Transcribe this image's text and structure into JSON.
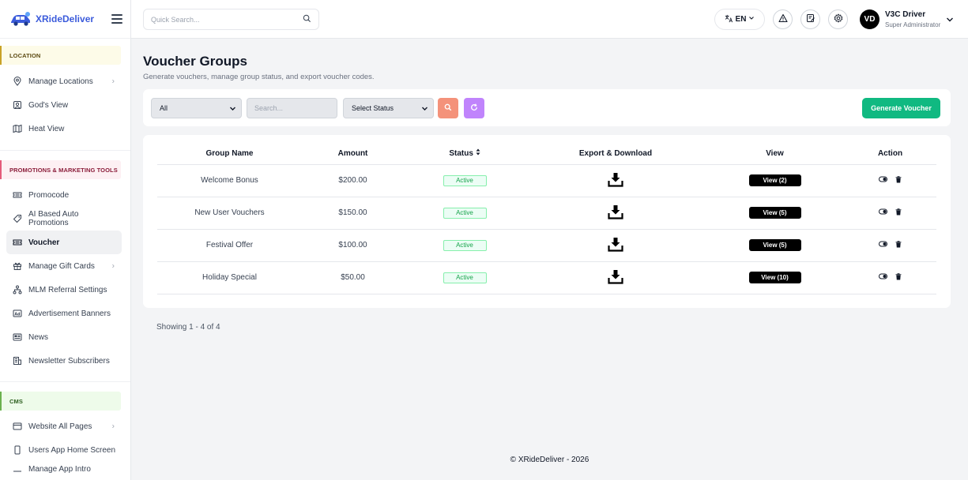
{
  "brand": {
    "name": "XRideDeliver"
  },
  "sidebar": {
    "sections": {
      "location": "LOCATION",
      "promotions": "PROMOTIONS & MARKETING TOOLS",
      "cms": "CMS"
    },
    "location_items": [
      "Manage Locations",
      "God's View",
      "Heat View"
    ],
    "promo_items": [
      "Promocode",
      "AI Based Auto Promotions",
      "Voucher",
      "Manage Gift Cards",
      "MLM Referral Settings",
      "Advertisement Banners",
      "News",
      "Newsletter Subscribers"
    ],
    "cms_items": [
      "Website All Pages",
      "Users App Home Screen",
      "Manage App Intro"
    ],
    "active_item": "Voucher"
  },
  "topbar": {
    "search_placeholder": "Quick Search...",
    "language": "EN",
    "user": {
      "initials": "VD",
      "name": "V3C Driver",
      "role": "Super Administrator"
    }
  },
  "page": {
    "title": "Voucher Groups",
    "subtitle": "Generate vouchers, manage group status, and export voucher codes."
  },
  "filters": {
    "type_value": "All",
    "search_placeholder": "Search...",
    "status_value": "Select Status",
    "generate_label": "Generate Voucher"
  },
  "table": {
    "headers": [
      "Group Name",
      "Amount",
      "Status",
      "Export & Download",
      "View",
      "Action"
    ],
    "status_sort_icon": "sort-icon",
    "rows": [
      {
        "name": "Welcome Bonus",
        "amount": "$200.00",
        "status": "Active",
        "view": "View (2)"
      },
      {
        "name": "New User Vouchers",
        "amount": "$150.00",
        "status": "Active",
        "view": "View (5)"
      },
      {
        "name": "Festival Offer",
        "amount": "$100.00",
        "status": "Active",
        "view": "View (5)"
      },
      {
        "name": "Holiday Special",
        "amount": "$50.00",
        "status": "Active",
        "view": "View (10)"
      }
    ]
  },
  "pagination": {
    "showing": "Showing 1 - 4 of 4"
  },
  "footer": {
    "text": "© XRideDeliver - 2026"
  },
  "colors": {
    "brand": "#3b5bdb",
    "generate": "#10b981",
    "search_btn": "#f4927a",
    "refresh_btn": "#c084fc"
  }
}
